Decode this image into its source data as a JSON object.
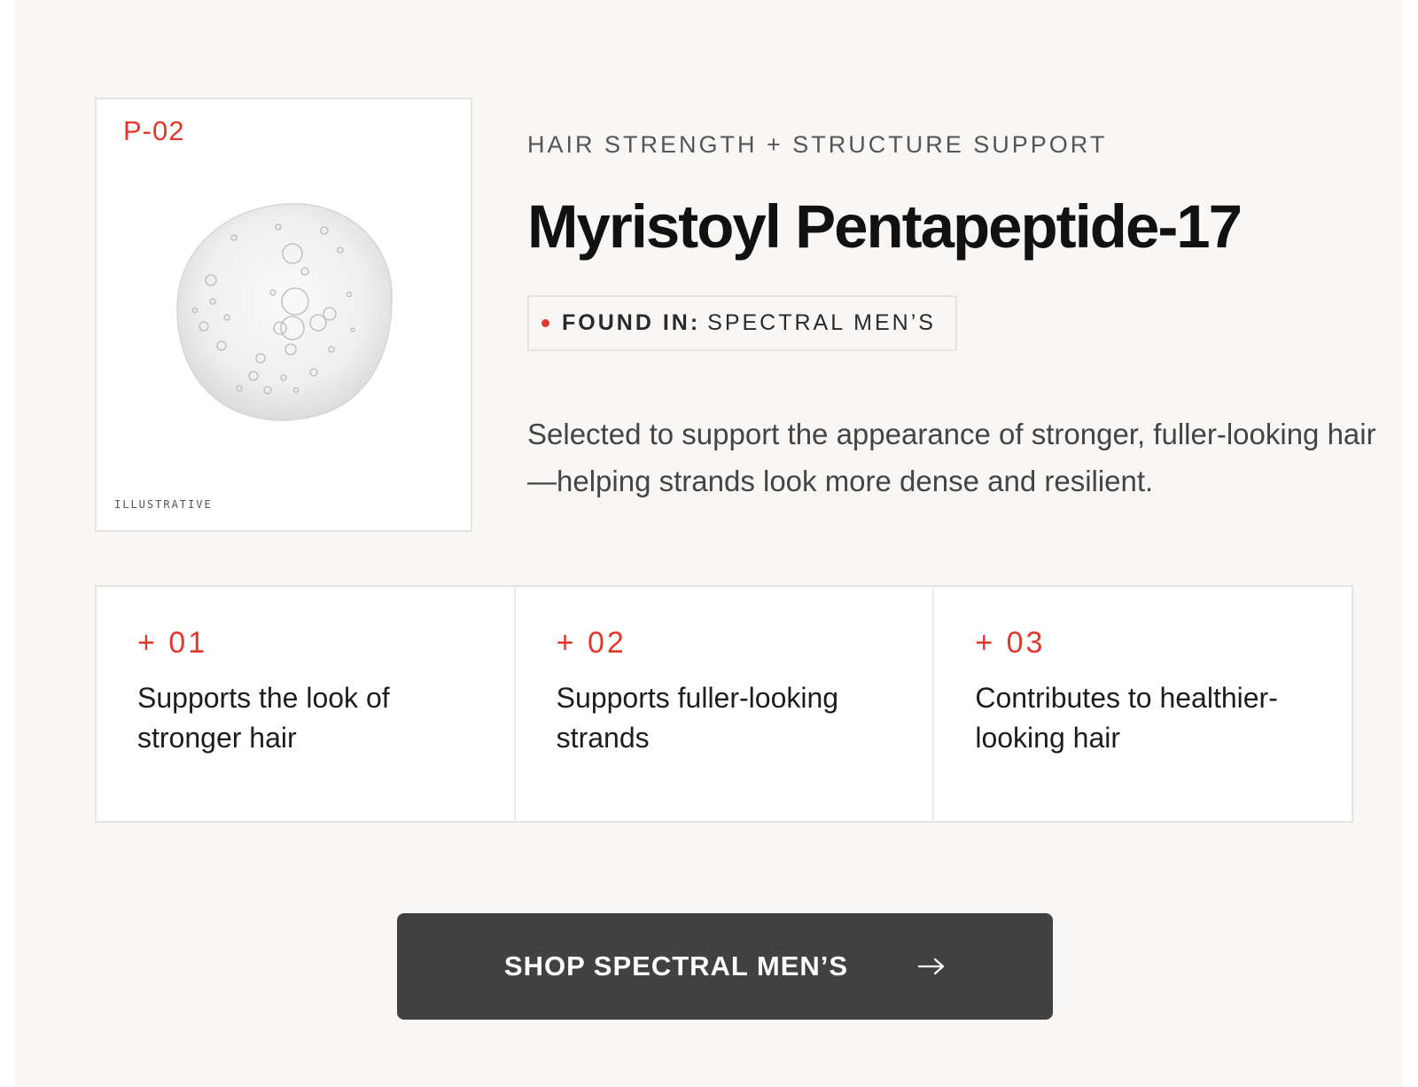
{
  "image_card": {
    "code": "P-02",
    "caption": "ILLUSTRATIVE",
    "image_alt": "serum droplet with bubbles"
  },
  "ingredient": {
    "eyebrow": "HAIR STRENGTH + STRUCTURE SUPPORT",
    "title": "Myristoyl Pentapeptide-17",
    "found_in_label": "FOUND IN:",
    "found_in_value": "SPECTRAL MEN’S",
    "description": "Selected to support the appearance of stronger, fuller-looking hair—helping strands look more dense and resilient."
  },
  "benefits": [
    {
      "number": "+ 01",
      "text": "Supports the look of stronger hair"
    },
    {
      "number": "+ 02",
      "text": "Supports fuller-looking strands"
    },
    {
      "number": "+ 03",
      "text": "Contributes to healthier-looking hair"
    }
  ],
  "cta": {
    "label": "SHOP SPECTRAL MEN’S",
    "icon": "arrow-right-icon"
  },
  "colors": {
    "accent": "#e0392c",
    "background": "#f8f7f5",
    "button": "#414141"
  }
}
